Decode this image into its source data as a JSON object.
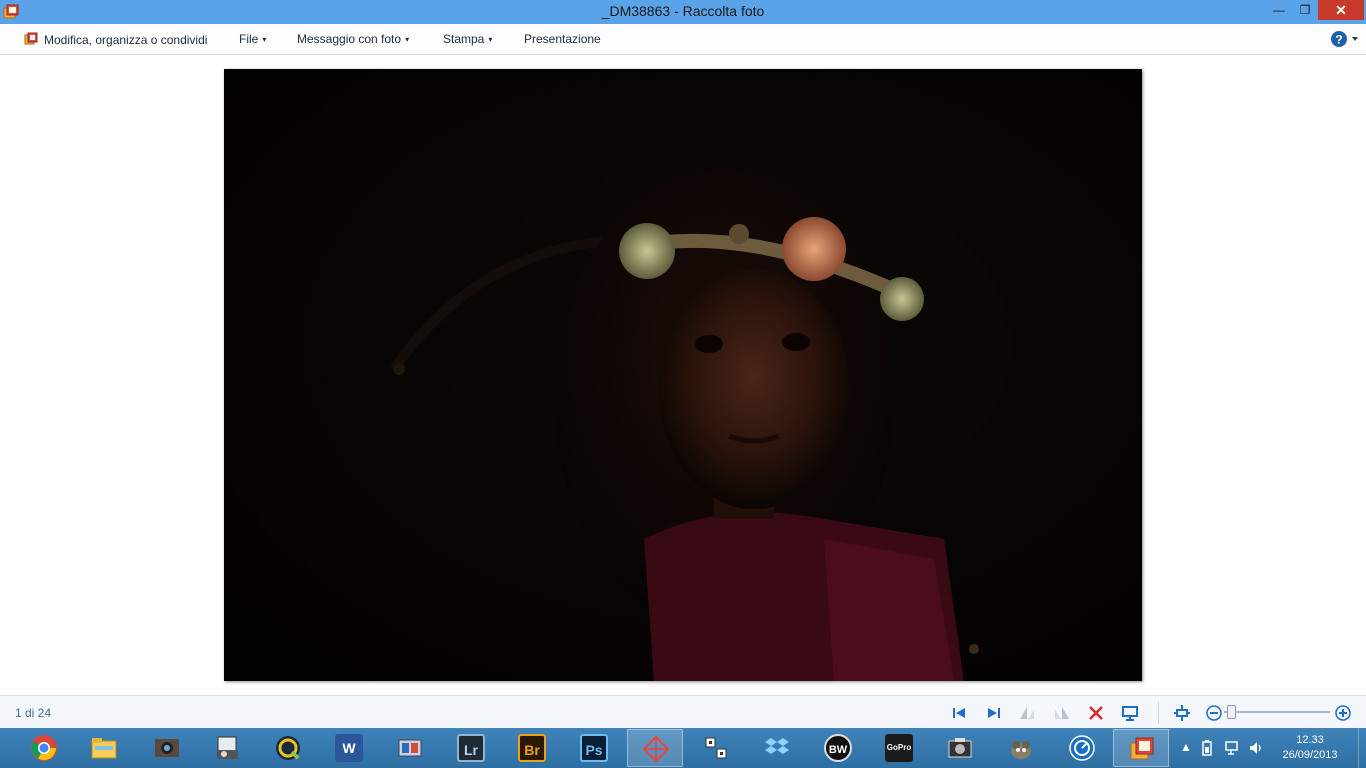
{
  "window": {
    "title": "_DM38863 - Raccolta foto",
    "minimize_symbol": "—",
    "maximize_symbol": "❐",
    "close_symbol": "✕"
  },
  "menu": {
    "edit_label": "Modifica, organizza o condividi",
    "file_label": "File",
    "email_label": "Messaggio con foto",
    "print_label": "Stampa",
    "slideshow_label": "Presentazione",
    "caret": "▾",
    "help_icon": "help-icon"
  },
  "photo": {
    "subject": "portrait-of-girl-with-flower-crown"
  },
  "status": {
    "counter": "1 di 24"
  },
  "controls": {
    "icons": [
      "first-icon",
      "last-icon",
      "rotate-left-icon",
      "rotate-right-icon",
      "delete-icon",
      "slideshow-icon",
      "fit-icon",
      "zoom-out-icon",
      "zoom-in-icon"
    ],
    "zoom_level": 0.03
  },
  "taskbar": {
    "apps": [
      {
        "name": "chrome",
        "label": ""
      },
      {
        "name": "file-explorer",
        "label": ""
      },
      {
        "name": "camera-app",
        "label": ""
      },
      {
        "name": "scanner",
        "label": ""
      },
      {
        "name": "quicktime",
        "label": ""
      },
      {
        "name": "word",
        "label": "W"
      },
      {
        "name": "media-app",
        "label": ""
      },
      {
        "name": "lightroom",
        "label": "Lr"
      },
      {
        "name": "bridge",
        "label": "Br"
      },
      {
        "name": "photoshop",
        "label": "Ps"
      },
      {
        "name": "network-app",
        "label": ""
      },
      {
        "name": "qr-app",
        "label": ""
      },
      {
        "name": "dropbox",
        "label": ""
      },
      {
        "name": "bw-app",
        "label": "BW"
      },
      {
        "name": "gopro",
        "label": "GoPro"
      },
      {
        "name": "screenshot-app",
        "label": ""
      },
      {
        "name": "gimp",
        "label": ""
      },
      {
        "name": "dashboard-app",
        "label": ""
      },
      {
        "name": "photo-gallery",
        "label": ""
      }
    ],
    "tray_arrow": "▲",
    "clock_time": "12.33",
    "clock_date": "26/09/2013"
  }
}
